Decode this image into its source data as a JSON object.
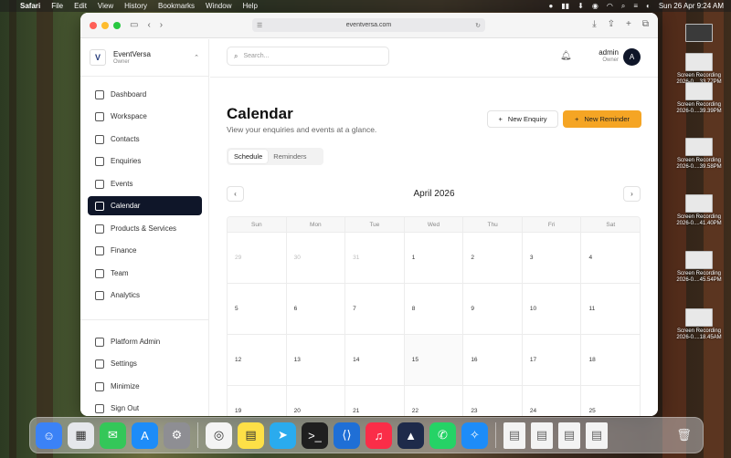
{
  "menubar": {
    "app": "Safari",
    "items": [
      "File",
      "Edit",
      "View",
      "History",
      "Bookmarks",
      "Window",
      "Help"
    ],
    "datetime": "Sun 26 Apr  9:24 AM"
  },
  "desktop": {
    "files": [
      {
        "line1": "",
        "line2": ""
      },
      {
        "line1": "Screen Recording",
        "line2": "2026-0....33.77PM"
      },
      {
        "line1": "Screen Recording",
        "line2": "2026-0....39.39PM"
      },
      {
        "line1": "Screen Recording",
        "line2": "2026-0....39.58PM"
      },
      {
        "line1": "Screen Recording",
        "line2": "2026-0....41.40PM"
      },
      {
        "line1": "Screen Recording",
        "line2": "2026-0....45.54PM"
      },
      {
        "line1": "Screen Recording",
        "line2": "2026-0....18.45AM"
      }
    ]
  },
  "browser": {
    "url": "eventversa.com"
  },
  "sidebar": {
    "org_name": "EventVersa",
    "org_role": "Owner",
    "org_logo": "V",
    "items": [
      {
        "label": "Dashboard",
        "icon": "home-icon"
      },
      {
        "label": "Workspace",
        "icon": "briefcase-icon"
      },
      {
        "label": "Contacts",
        "icon": "contacts-icon"
      },
      {
        "label": "Enquiries",
        "icon": "document-icon"
      },
      {
        "label": "Events",
        "icon": "flag-icon"
      },
      {
        "label": "Calendar",
        "icon": "calendar-icon",
        "active": true
      },
      {
        "label": "Products & Services",
        "icon": "box-icon"
      },
      {
        "label": "Finance",
        "icon": "receipt-icon"
      },
      {
        "label": "Team",
        "icon": "team-icon"
      },
      {
        "label": "Analytics",
        "icon": "chart-icon"
      }
    ],
    "footer_items": [
      {
        "label": "Platform Admin",
        "icon": "shield-icon"
      },
      {
        "label": "Settings",
        "icon": "gear-icon"
      },
      {
        "label": "Minimize",
        "icon": "collapse-icon"
      },
      {
        "label": "Sign Out",
        "icon": "signout-icon"
      }
    ]
  },
  "header": {
    "search_placeholder": "Search...",
    "user_name": "admin",
    "user_role": "Owner",
    "avatar_initial": "A"
  },
  "page": {
    "title": "Calendar",
    "subtitle": "View your enquiries and events at a glance.",
    "new_enquiry": "New Enquiry",
    "new_reminder": "New Reminder",
    "tabs": [
      "Schedule",
      "Reminders"
    ],
    "active_tab": "Schedule"
  },
  "calendar": {
    "month": "April 2026",
    "weekdays": [
      "Sun",
      "Mon",
      "Tue",
      "Wed",
      "Thu",
      "Fri",
      "Sat"
    ],
    "weeks": [
      [
        {
          "d": "29",
          "m": true
        },
        {
          "d": "30",
          "m": true
        },
        {
          "d": "31",
          "m": true
        },
        {
          "d": "1"
        },
        {
          "d": "2"
        },
        {
          "d": "3"
        },
        {
          "d": "4"
        }
      ],
      [
        {
          "d": "5"
        },
        {
          "d": "6"
        },
        {
          "d": "7"
        },
        {
          "d": "8"
        },
        {
          "d": "9"
        },
        {
          "d": "10"
        },
        {
          "d": "11"
        }
      ],
      [
        {
          "d": "12"
        },
        {
          "d": "13"
        },
        {
          "d": "14"
        },
        {
          "d": "15"
        },
        {
          "d": "16"
        },
        {
          "d": "17"
        },
        {
          "d": "18"
        }
      ],
      [
        {
          "d": "19"
        },
        {
          "d": "20"
        },
        {
          "d": "21"
        },
        {
          "d": "22"
        },
        {
          "d": "23"
        },
        {
          "d": "24"
        },
        {
          "d": "25"
        }
      ]
    ]
  },
  "dock": {
    "apps": [
      {
        "name": "finder-icon",
        "color": "#3b82f6"
      },
      {
        "name": "launchpad-icon",
        "color": "#e5e7eb"
      },
      {
        "name": "messages-icon",
        "color": "#34c759"
      },
      {
        "name": "app-store-icon",
        "color": "#1d8cf8"
      },
      {
        "name": "system-settings-icon",
        "color": "#8e8e93"
      },
      {
        "name": "chrome-icon",
        "color": "#f4f4f4"
      },
      {
        "name": "notes-icon",
        "color": "#fde047"
      },
      {
        "name": "telegram-icon",
        "color": "#2aabee"
      },
      {
        "name": "terminal-icon",
        "color": "#1f1f1f"
      },
      {
        "name": "vscode-icon",
        "color": "#1f6fd6"
      },
      {
        "name": "music-icon",
        "color": "#fa2d48"
      },
      {
        "name": "affinity-icon",
        "color": "#1e2a4a"
      },
      {
        "name": "whatsapp-icon",
        "color": "#25d366"
      },
      {
        "name": "safari-icon",
        "color": "#1d8cf8"
      }
    ]
  }
}
